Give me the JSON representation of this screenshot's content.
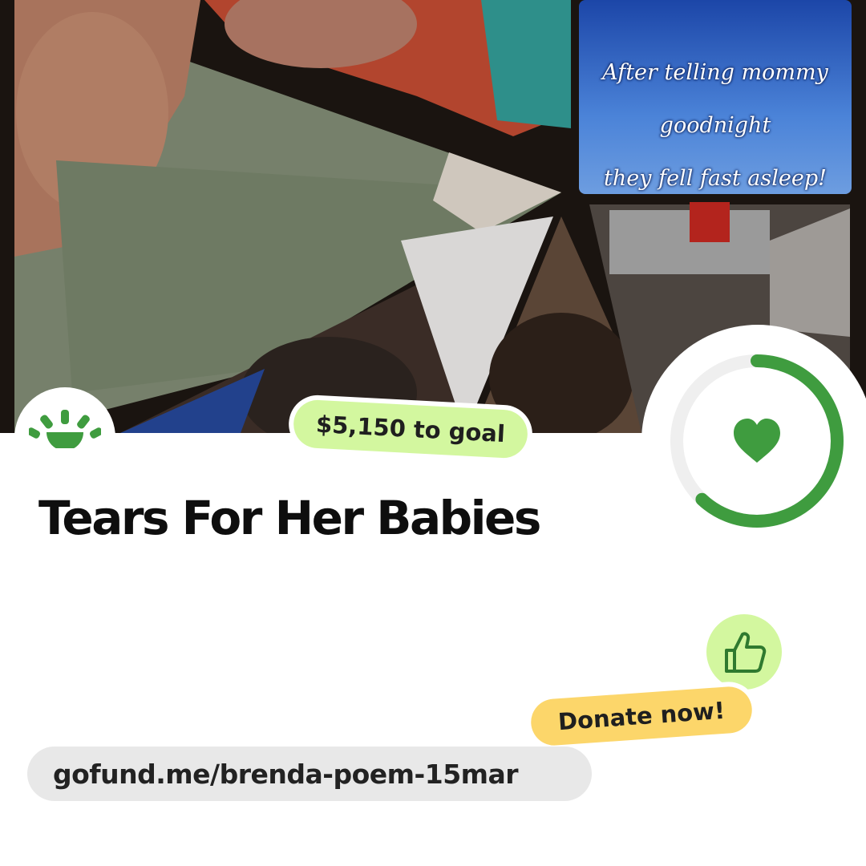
{
  "photo": {
    "caption_lines": [
      "After telling mommy",
      "goodnight",
      "they fell fast asleep!"
    ]
  },
  "campaign": {
    "goal_text": "$5,150 to goal",
    "title": "Tears For Her Babies",
    "progress_fraction": 0.62,
    "cta_label": "Donate now!",
    "url": "gofund.me/brenda-poem-15mar"
  },
  "colors": {
    "brand_green": "#3f9c3f",
    "goal_pill": "#d3f79f",
    "donate_pill": "#fcd66a",
    "url_pill": "#e8e8e8"
  },
  "icons": {
    "logo": "sunrise-logo-icon",
    "progress_center": "heart-icon",
    "badge": "thumbs-up-icon"
  }
}
